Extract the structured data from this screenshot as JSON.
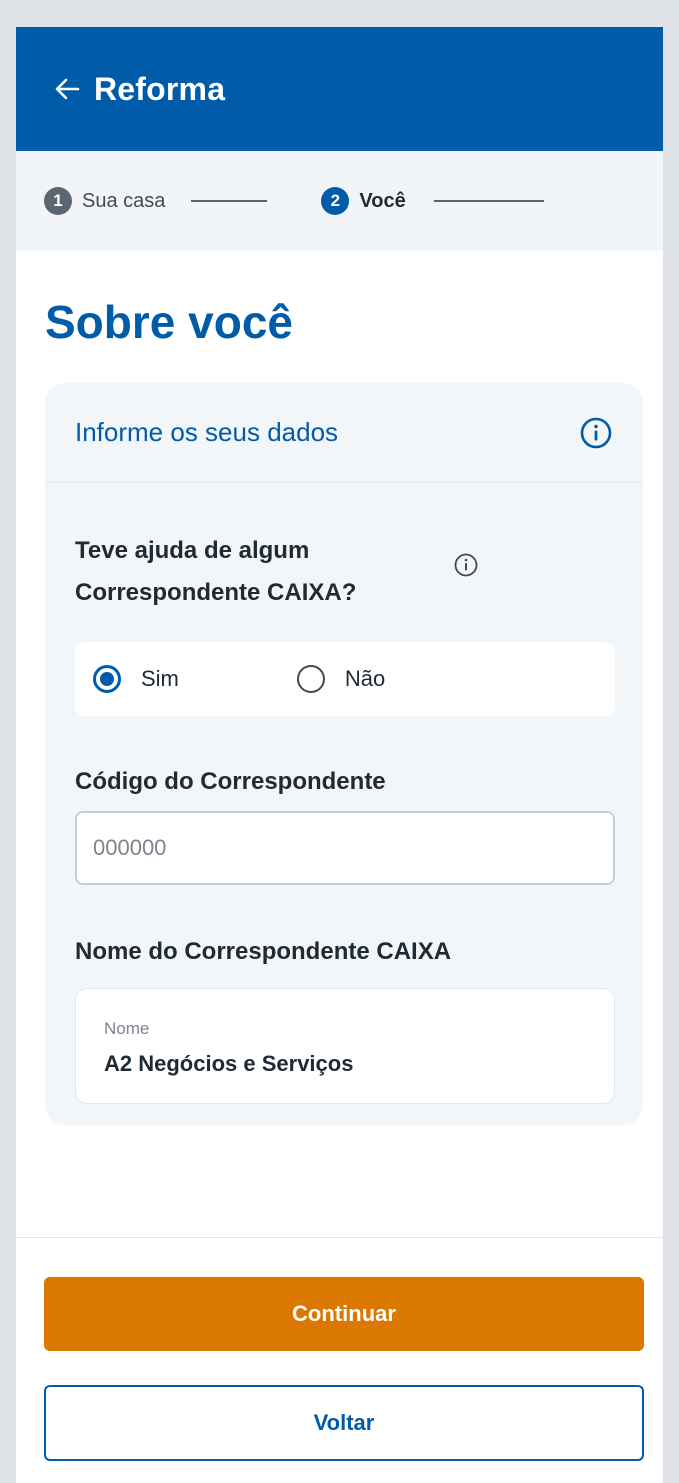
{
  "header": {
    "title": "Reforma",
    "back_icon": "arrow-left-icon",
    "background_color": "#005ca9"
  },
  "stepper": {
    "steps": [
      {
        "number": "1",
        "label": "Sua casa",
        "state": "completed"
      },
      {
        "number": "2",
        "label": "Você",
        "state": "active"
      }
    ]
  },
  "page": {
    "title": "Sobre você"
  },
  "card": {
    "title": "Informe os seus dados",
    "info_icon": "info-icon",
    "question": "Teve ajuda de algum Correspondente CAIXA?",
    "options": [
      {
        "label": "Sim",
        "selected": true
      },
      {
        "label": "Não",
        "selected": false
      }
    ],
    "code_label": "Código do Correspondente",
    "code_placeholder": "000000",
    "code_value": "",
    "name_label": "Nome do Correspondente CAIXA",
    "name_caption": "Nome",
    "name_value": "A2 Negócios e Serviços"
  },
  "actions": {
    "continue_label": "Continuar",
    "back_label": "Voltar",
    "primary_color": "#db7800"
  }
}
